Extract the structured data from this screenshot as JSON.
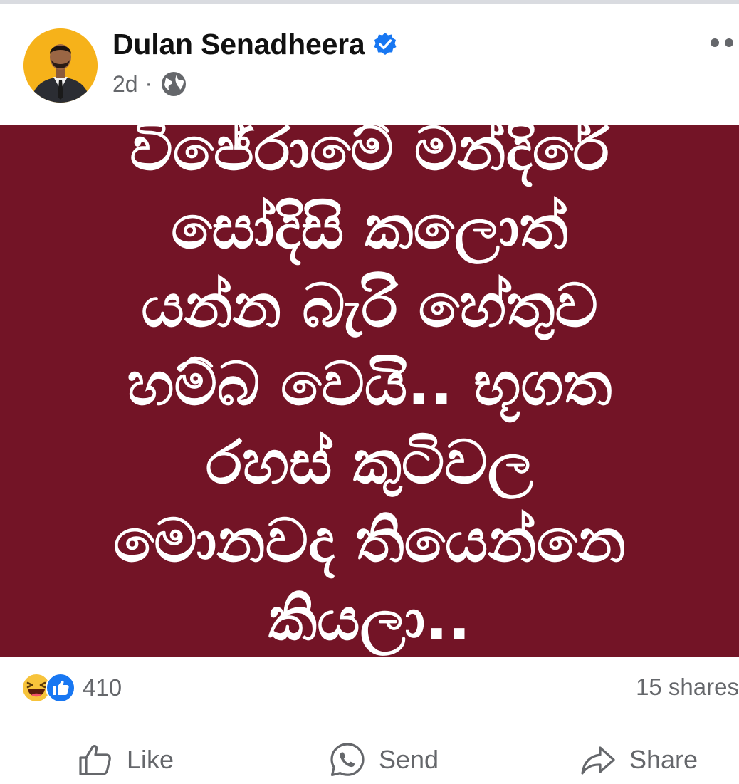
{
  "post": {
    "author_name": "Dulan Senadheera",
    "time": "2d",
    "separator": "·",
    "body_text": "විජේරාමේ මන්දිරේ\nසෝදිසි කලොත්\nයන්න බැරි හේතුව\nහම්බ වෙයි..  භූගත\nරහස් කුටිවල\nමොනවද තියෙන්නෙ\nකියලා..",
    "background_color": "#731426"
  },
  "stats": {
    "reaction_count": "410",
    "shares": "15 shares"
  },
  "actions": {
    "like_label": "Like",
    "send_label": "Send",
    "share_label": "Share"
  }
}
